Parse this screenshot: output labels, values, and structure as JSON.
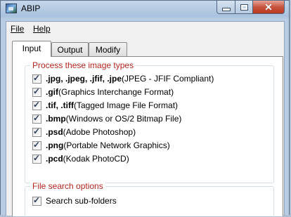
{
  "window": {
    "title": "ABIP",
    "accent": "#c8553f"
  },
  "menu": {
    "file": "File",
    "help": "Help"
  },
  "tabs": [
    {
      "label": "Input",
      "selected": true
    },
    {
      "label": "Output",
      "selected": false
    },
    {
      "label": "Modify",
      "selected": false
    }
  ],
  "image_types": {
    "title": "Process these image types",
    "items": [
      {
        "ext": ".jpg, .jpeg, .jfif, .jpe",
        "desc": " (JPEG - JFIF Compliant)",
        "checked": true
      },
      {
        "ext": ".gif",
        "desc": " (Graphics Interchange Format)",
        "checked": true
      },
      {
        "ext": ".tif, .tiff",
        "desc": " (Tagged Image File Format)",
        "checked": true
      },
      {
        "ext": ".bmp",
        "desc": " (Windows or OS/2 Bitmap File)",
        "checked": true
      },
      {
        "ext": ".psd",
        "desc": " (Adobe Photoshop)",
        "checked": true
      },
      {
        "ext": ".png",
        "desc": " (Portable Network Graphics)",
        "checked": true
      },
      {
        "ext": ".pcd",
        "desc": " (Kodak PhotoCD)",
        "checked": true
      }
    ]
  },
  "search_options": {
    "title": "File search options",
    "subfolders_label": "Search sub-folders",
    "subfolders_checked": true
  },
  "icons": {
    "check": "✓",
    "close": "✕"
  }
}
